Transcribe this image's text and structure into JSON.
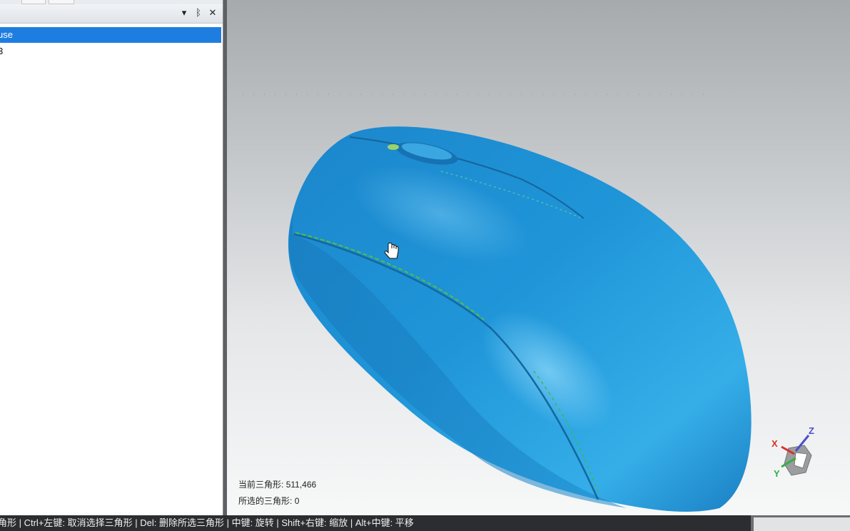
{
  "panel": {
    "dropdown_icon": "▾",
    "pin_icon": "ᛒ",
    "close_icon": "✕",
    "tree": [
      {
        "label": "use",
        "selected": true
      },
      {
        "label": "3",
        "selected": false
      }
    ]
  },
  "viewport": {
    "current_triangles_label": "当前三角形:",
    "current_triangles_value": "511,466",
    "selected_triangles_label": "所选的三角形:",
    "selected_triangles_value": "0",
    "axes": {
      "x": "X",
      "y": "Y",
      "z": "Z"
    },
    "model_color": "#1f8fd1"
  },
  "status": {
    "hint": "角形 | Ctrl+左键: 取消选择三角形 | Del: 删除所选三角形 | 中键: 旋转 | Shift+右键: 缩放 | Alt+中键: 平移"
  }
}
